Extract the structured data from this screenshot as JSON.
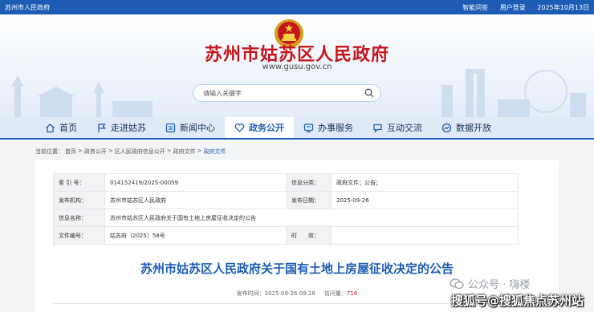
{
  "topbar": {
    "site_name": "苏州市人民政府",
    "links": [
      "智能问答",
      "用户登录",
      "2025年10月13日"
    ]
  },
  "header": {
    "title": "苏州市姑苏区人民政府",
    "url": "www.gusu.gov.cn"
  },
  "search": {
    "placeholder": "请输入关键字"
  },
  "nav": {
    "items": [
      {
        "label": "首页",
        "icon": "home-icon"
      },
      {
        "label": "走进姑苏",
        "icon": "flag-icon"
      },
      {
        "label": "新闻中心",
        "icon": "news-icon"
      },
      {
        "label": "政务公开",
        "icon": "heart-icon"
      },
      {
        "label": "办事服务",
        "icon": "service-icon"
      },
      {
        "label": "互动交流",
        "icon": "chat-icon"
      },
      {
        "label": "数据开放",
        "icon": "data-icon"
      }
    ],
    "active_index": 3
  },
  "breadcrumb": {
    "prefix": "当前位置：",
    "items": [
      "首页",
      "政务公开",
      "区人民政府信息公开",
      "政府文件",
      "政府文件"
    ]
  },
  "meta": {
    "index_label": "索 引 号：",
    "index_value": "014152419/2025-00059",
    "category_label": "信息分类：",
    "category_value": "政府文件；公告；",
    "publisher_label": "发布机构：",
    "publisher_value": "苏州市姑苏区人民政府",
    "date_label": "发布日期：",
    "date_value": "2025-09-26",
    "name_label": "信息名称：",
    "name_value": "苏州市姑苏区人民政府关于国有土地上房屋征收决定的公告",
    "docno_label": "文件编号：",
    "docno_value": "姑苏府〔2025〕58号",
    "validity_label": "时　　效：",
    "validity_value": ""
  },
  "document": {
    "title": "苏州市姑苏区人民政府关于国有土地上房屋征收决定的公告",
    "published_label": "发布时间：",
    "published_time": "2025-09-26 09:28",
    "views_label": "访问量：",
    "views": "716"
  },
  "watermark": {
    "line1": "公众号 · 嗨楼",
    "line2": "搜狐号@搜狐焦点苏州站"
  },
  "colors": {
    "brand_blue": "#1d5cb4",
    "title_red": "#c4161c"
  }
}
